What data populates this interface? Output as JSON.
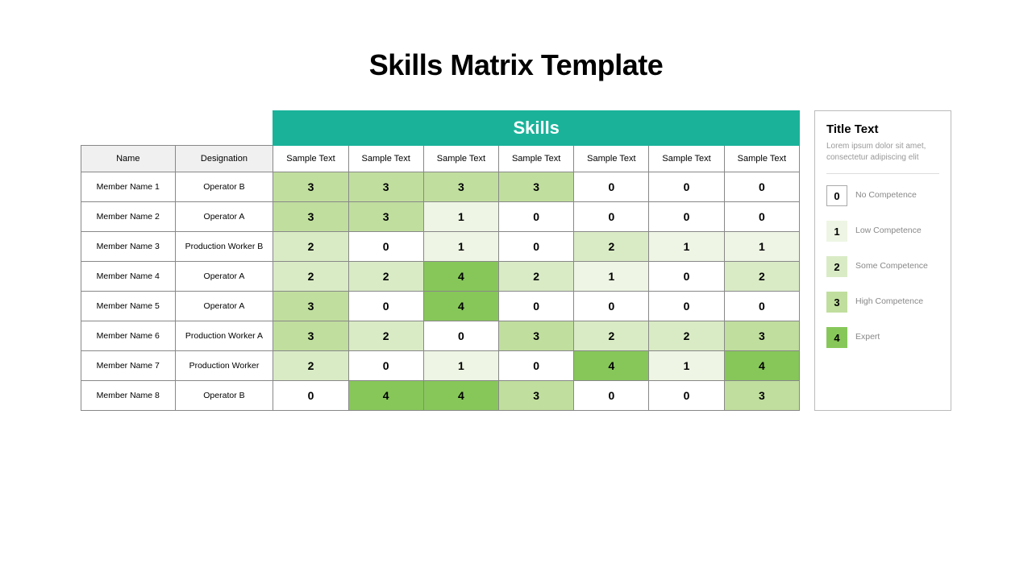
{
  "title": "Skills Matrix Template",
  "skills_header": "Skills",
  "columns": {
    "name": "Name",
    "designation": "Designation"
  },
  "skill_columns": [
    "Sample Text",
    "Sample Text",
    "Sample Text",
    "Sample Text",
    "Sample Text",
    "Sample Text",
    "Sample Text"
  ],
  "rows": [
    {
      "name": "Member Name 1",
      "designation": "Operator B",
      "scores": [
        3,
        3,
        3,
        3,
        0,
        0,
        0
      ]
    },
    {
      "name": "Member Name 2",
      "designation": "Operator A",
      "scores": [
        3,
        3,
        1,
        0,
        0,
        0,
        0
      ]
    },
    {
      "name": "Member Name 3",
      "designation": "Production Worker B",
      "scores": [
        2,
        0,
        1,
        0,
        2,
        1,
        1
      ]
    },
    {
      "name": "Member Name 4",
      "designation": "Operator A",
      "scores": [
        2,
        2,
        4,
        2,
        1,
        0,
        2
      ]
    },
    {
      "name": "Member Name 5",
      "designation": "Operator A",
      "scores": [
        3,
        0,
        4,
        0,
        0,
        0,
        0
      ]
    },
    {
      "name": "Member Name 6",
      "designation": "Production Worker A",
      "scores": [
        3,
        2,
        0,
        3,
        2,
        2,
        3
      ]
    },
    {
      "name": "Member Name 7",
      "designation": "Production Worker",
      "scores": [
        2,
        0,
        1,
        0,
        4,
        1,
        4
      ]
    },
    {
      "name": "Member Name 8",
      "designation": "Operator B",
      "scores": [
        0,
        4,
        4,
        3,
        0,
        0,
        3
      ]
    }
  ],
  "legend": {
    "title": "Title Text",
    "subtitle": "Lorem ipsum dolor sit amet, consectetur adipiscing elit",
    "items": [
      {
        "value": "0",
        "label": "No Competence"
      },
      {
        "value": "1",
        "label": "Low Competence"
      },
      {
        "value": "2",
        "label": "Some Competence"
      },
      {
        "value": "3",
        "label": "High Competence"
      },
      {
        "value": "4",
        "label": "Expert"
      }
    ]
  },
  "chart_data": {
    "type": "table",
    "title": "Skills Matrix Template",
    "row_labels": [
      "Member Name 1",
      "Member Name 2",
      "Member Name 3",
      "Member Name 4",
      "Member Name 5",
      "Member Name 6",
      "Member Name 7",
      "Member Name 8"
    ],
    "col_labels": [
      "Sample Text",
      "Sample Text",
      "Sample Text",
      "Sample Text",
      "Sample Text",
      "Sample Text",
      "Sample Text"
    ],
    "values": [
      [
        3,
        3,
        3,
        3,
        0,
        0,
        0
      ],
      [
        3,
        3,
        1,
        0,
        0,
        0,
        0
      ],
      [
        2,
        0,
        1,
        0,
        2,
        1,
        1
      ],
      [
        2,
        2,
        4,
        2,
        1,
        0,
        2
      ],
      [
        3,
        0,
        4,
        0,
        0,
        0,
        0
      ],
      [
        3,
        2,
        0,
        3,
        2,
        2,
        3
      ],
      [
        2,
        0,
        1,
        0,
        4,
        1,
        4
      ],
      [
        0,
        4,
        4,
        3,
        0,
        0,
        3
      ]
    ],
    "scale": {
      "0": "No Competence",
      "1": "Low Competence",
      "2": "Some Competence",
      "3": "High Competence",
      "4": "Expert"
    }
  }
}
